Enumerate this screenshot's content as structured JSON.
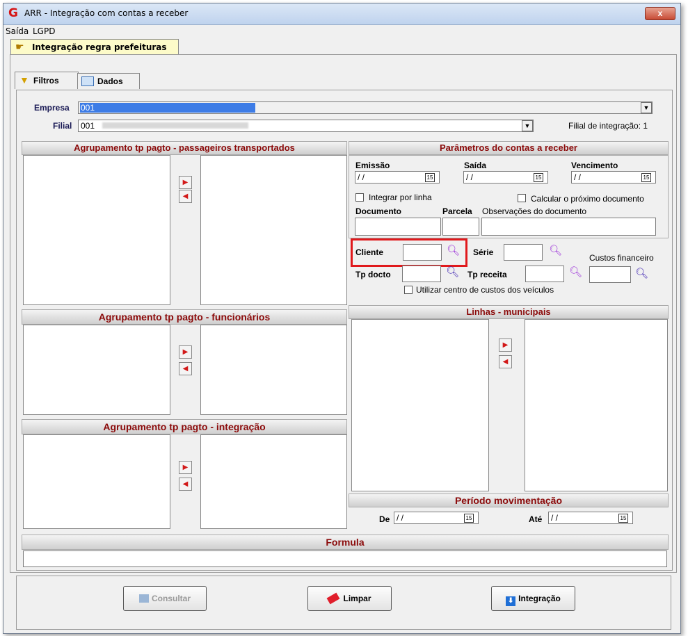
{
  "window": {
    "title": "ARR - Integração com contas a receber",
    "logo": "G",
    "close_label": "x"
  },
  "menu": {
    "items": [
      "Saída",
      "LGPD"
    ]
  },
  "top_tab": {
    "label": "Integração regra prefeituras"
  },
  "subtabs": {
    "filtros": "Filtros",
    "dados": "Dados"
  },
  "empresa": {
    "label": "Empresa",
    "value": "001"
  },
  "filial": {
    "label": "Filial",
    "value": "001",
    "integracao_label": "Filial de integração: 1"
  },
  "sections": {
    "passageiros": "Agrupamento tp pagto - passageiros transportados",
    "funcionarios": "Agrupamento tp pagto - funcionários",
    "integracao": "Agrupamento tp pagto - integração",
    "parametros": "Parâmetros do contas a receber",
    "linhas": "Linhas - municipais",
    "periodo": "Período movimentação",
    "formula": "Formula"
  },
  "parametros": {
    "emissao_label": "Emissão",
    "saida_label": "Saída",
    "vencimento_label": "Vencimento",
    "date_placeholder": "/ /",
    "integrar_label": "Integrar por linha",
    "calcular_label": "Calcular o próximo documento",
    "documento_label": "Documento",
    "parcela_label": "Parcela",
    "observacoes_label": "Observações do documento",
    "cliente_label": "Cliente",
    "serie_label": "Série",
    "custos_label": "Custos financeiro",
    "tpdocto_label": "Tp docto",
    "tpreceita_label": "Tp receita",
    "centro_label": "Utilizar centro de custos dos veículos"
  },
  "periodo": {
    "de_label": "De",
    "ate_label": "Até",
    "de_value": "/ /",
    "ate_value": "/ /"
  },
  "buttons": {
    "consultar": "Consultar",
    "limpar": "Limpar",
    "integracao": "Integração"
  },
  "colors": {
    "section_text": "#8b0a0a",
    "highlight": "#e0191c",
    "search_icon": "#9b30d9",
    "search_icon_dark": "#3a1fb0"
  }
}
